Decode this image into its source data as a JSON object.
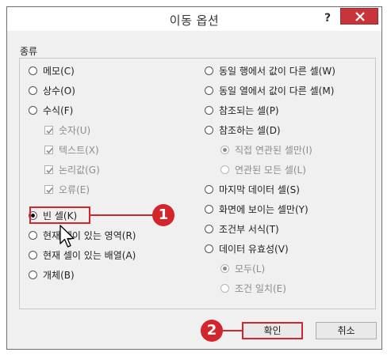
{
  "dialog": {
    "title": "이동 옵션",
    "help_label": "?",
    "group_label": "종류"
  },
  "left_options": [
    {
      "label": "메모(C)",
      "type": "radio",
      "checked": false,
      "disabled": false
    },
    {
      "label": "상수(O)",
      "type": "radio",
      "checked": false,
      "disabled": false
    },
    {
      "label": "수식(F)",
      "type": "radio",
      "checked": false,
      "disabled": false
    },
    {
      "label": "숫자(U)",
      "type": "checkbox",
      "checked": true,
      "disabled": true
    },
    {
      "label": "텍스트(X)",
      "type": "checkbox",
      "checked": true,
      "disabled": true
    },
    {
      "label": "논리값(G)",
      "type": "checkbox",
      "checked": true,
      "disabled": true
    },
    {
      "label": "오류(E)",
      "type": "checkbox",
      "checked": true,
      "disabled": true
    },
    {
      "label": "빈 셀(K)",
      "type": "radio",
      "checked": true,
      "disabled": false
    },
    {
      "label": "현재 셀이 있는 영역(R)",
      "type": "radio",
      "checked": false,
      "disabled": false
    },
    {
      "label": "현재 셀이 있는 배열(A)",
      "type": "radio",
      "checked": false,
      "disabled": false
    },
    {
      "label": "개체(B)",
      "type": "radio",
      "checked": false,
      "disabled": false
    }
  ],
  "right_options": [
    {
      "label": "동일 행에서 값이 다른 셀(W)",
      "type": "radio",
      "checked": false,
      "disabled": false
    },
    {
      "label": "동일 열에서 값이 다른 셀(M)",
      "type": "radio",
      "checked": false,
      "disabled": false
    },
    {
      "label": "참조되는 셀(P)",
      "type": "radio",
      "checked": false,
      "disabled": false
    },
    {
      "label": "참조하는 셀(D)",
      "type": "radio",
      "checked": false,
      "disabled": false
    },
    {
      "label": "직접 연관된 셀만(I)",
      "type": "radio",
      "checked": true,
      "disabled": true
    },
    {
      "label": "연관된 모든 셀(L)",
      "type": "radio",
      "checked": false,
      "disabled": true
    },
    {
      "label": "마지막 데이터 셀(S)",
      "type": "radio",
      "checked": false,
      "disabled": false
    },
    {
      "label": "화면에 보이는 셀만(Y)",
      "type": "radio",
      "checked": false,
      "disabled": false
    },
    {
      "label": "조건부 서식(T)",
      "type": "radio",
      "checked": false,
      "disabled": false
    },
    {
      "label": "데이터 유효성(V)",
      "type": "radio",
      "checked": false,
      "disabled": false
    },
    {
      "label": "모두(L)",
      "type": "radio",
      "checked": true,
      "disabled": true
    },
    {
      "label": "조건 일치(E)",
      "type": "radio",
      "checked": false,
      "disabled": true
    }
  ],
  "buttons": {
    "ok_label": "확인",
    "cancel_label": "취소"
  },
  "callouts": {
    "first": "1",
    "second": "2"
  },
  "colors": {
    "close_button": "#c7353a",
    "callout": "#d3262c",
    "dialog_bg": "#f0f0f0"
  },
  "icons": [
    "close-icon",
    "check-icon",
    "mouse-pointer-icon"
  ]
}
